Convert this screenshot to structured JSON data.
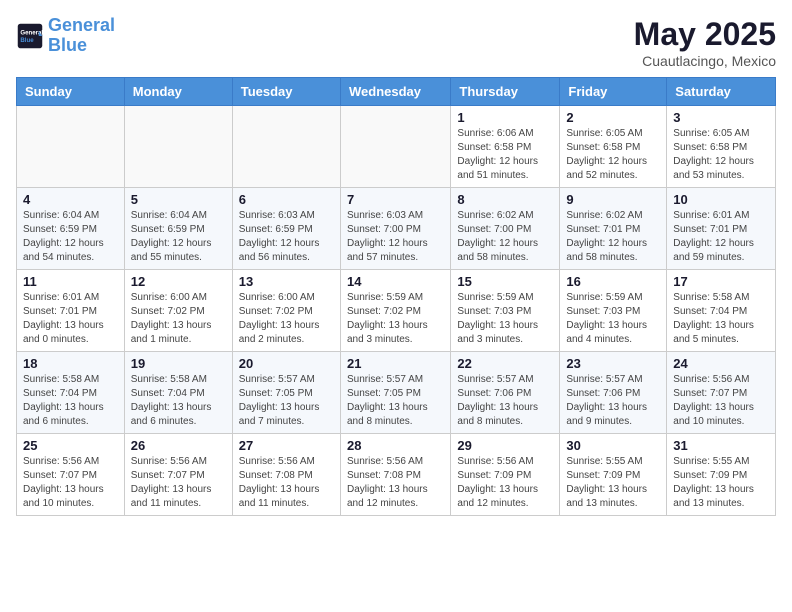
{
  "header": {
    "logo_line1": "General",
    "logo_line2": "Blue",
    "month": "May 2025",
    "location": "Cuautlacingo, Mexico"
  },
  "weekdays": [
    "Sunday",
    "Monday",
    "Tuesday",
    "Wednesday",
    "Thursday",
    "Friday",
    "Saturday"
  ],
  "weeks": [
    [
      {
        "day": "",
        "info": ""
      },
      {
        "day": "",
        "info": ""
      },
      {
        "day": "",
        "info": ""
      },
      {
        "day": "",
        "info": ""
      },
      {
        "day": "1",
        "info": "Sunrise: 6:06 AM\nSunset: 6:58 PM\nDaylight: 12 hours\nand 51 minutes."
      },
      {
        "day": "2",
        "info": "Sunrise: 6:05 AM\nSunset: 6:58 PM\nDaylight: 12 hours\nand 52 minutes."
      },
      {
        "day": "3",
        "info": "Sunrise: 6:05 AM\nSunset: 6:58 PM\nDaylight: 12 hours\nand 53 minutes."
      }
    ],
    [
      {
        "day": "4",
        "info": "Sunrise: 6:04 AM\nSunset: 6:59 PM\nDaylight: 12 hours\nand 54 minutes."
      },
      {
        "day": "5",
        "info": "Sunrise: 6:04 AM\nSunset: 6:59 PM\nDaylight: 12 hours\nand 55 minutes."
      },
      {
        "day": "6",
        "info": "Sunrise: 6:03 AM\nSunset: 6:59 PM\nDaylight: 12 hours\nand 56 minutes."
      },
      {
        "day": "7",
        "info": "Sunrise: 6:03 AM\nSunset: 7:00 PM\nDaylight: 12 hours\nand 57 minutes."
      },
      {
        "day": "8",
        "info": "Sunrise: 6:02 AM\nSunset: 7:00 PM\nDaylight: 12 hours\nand 58 minutes."
      },
      {
        "day": "9",
        "info": "Sunrise: 6:02 AM\nSunset: 7:01 PM\nDaylight: 12 hours\nand 58 minutes."
      },
      {
        "day": "10",
        "info": "Sunrise: 6:01 AM\nSunset: 7:01 PM\nDaylight: 12 hours\nand 59 minutes."
      }
    ],
    [
      {
        "day": "11",
        "info": "Sunrise: 6:01 AM\nSunset: 7:01 PM\nDaylight: 13 hours\nand 0 minutes."
      },
      {
        "day": "12",
        "info": "Sunrise: 6:00 AM\nSunset: 7:02 PM\nDaylight: 13 hours\nand 1 minute."
      },
      {
        "day": "13",
        "info": "Sunrise: 6:00 AM\nSunset: 7:02 PM\nDaylight: 13 hours\nand 2 minutes."
      },
      {
        "day": "14",
        "info": "Sunrise: 5:59 AM\nSunset: 7:02 PM\nDaylight: 13 hours\nand 3 minutes."
      },
      {
        "day": "15",
        "info": "Sunrise: 5:59 AM\nSunset: 7:03 PM\nDaylight: 13 hours\nand 3 minutes."
      },
      {
        "day": "16",
        "info": "Sunrise: 5:59 AM\nSunset: 7:03 PM\nDaylight: 13 hours\nand 4 minutes."
      },
      {
        "day": "17",
        "info": "Sunrise: 5:58 AM\nSunset: 7:04 PM\nDaylight: 13 hours\nand 5 minutes."
      }
    ],
    [
      {
        "day": "18",
        "info": "Sunrise: 5:58 AM\nSunset: 7:04 PM\nDaylight: 13 hours\nand 6 minutes."
      },
      {
        "day": "19",
        "info": "Sunrise: 5:58 AM\nSunset: 7:04 PM\nDaylight: 13 hours\nand 6 minutes."
      },
      {
        "day": "20",
        "info": "Sunrise: 5:57 AM\nSunset: 7:05 PM\nDaylight: 13 hours\nand 7 minutes."
      },
      {
        "day": "21",
        "info": "Sunrise: 5:57 AM\nSunset: 7:05 PM\nDaylight: 13 hours\nand 8 minutes."
      },
      {
        "day": "22",
        "info": "Sunrise: 5:57 AM\nSunset: 7:06 PM\nDaylight: 13 hours\nand 8 minutes."
      },
      {
        "day": "23",
        "info": "Sunrise: 5:57 AM\nSunset: 7:06 PM\nDaylight: 13 hours\nand 9 minutes."
      },
      {
        "day": "24",
        "info": "Sunrise: 5:56 AM\nSunset: 7:07 PM\nDaylight: 13 hours\nand 10 minutes."
      }
    ],
    [
      {
        "day": "25",
        "info": "Sunrise: 5:56 AM\nSunset: 7:07 PM\nDaylight: 13 hours\nand 10 minutes."
      },
      {
        "day": "26",
        "info": "Sunrise: 5:56 AM\nSunset: 7:07 PM\nDaylight: 13 hours\nand 11 minutes."
      },
      {
        "day": "27",
        "info": "Sunrise: 5:56 AM\nSunset: 7:08 PM\nDaylight: 13 hours\nand 11 minutes."
      },
      {
        "day": "28",
        "info": "Sunrise: 5:56 AM\nSunset: 7:08 PM\nDaylight: 13 hours\nand 12 minutes."
      },
      {
        "day": "29",
        "info": "Sunrise: 5:56 AM\nSunset: 7:09 PM\nDaylight: 13 hours\nand 12 minutes."
      },
      {
        "day": "30",
        "info": "Sunrise: 5:55 AM\nSunset: 7:09 PM\nDaylight: 13 hours\nand 13 minutes."
      },
      {
        "day": "31",
        "info": "Sunrise: 5:55 AM\nSunset: 7:09 PM\nDaylight: 13 hours\nand 13 minutes."
      }
    ]
  ]
}
